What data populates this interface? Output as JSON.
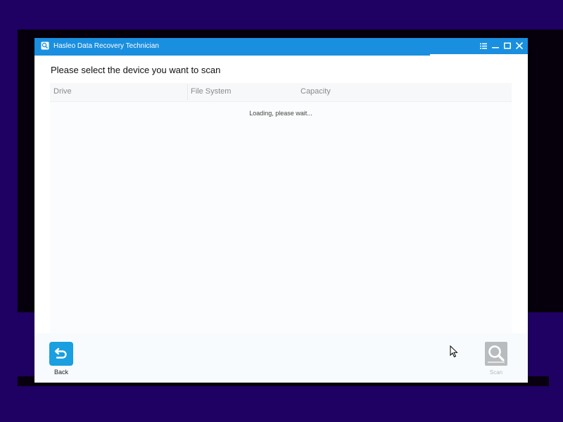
{
  "window": {
    "title": "Hasleo Data Recovery Technician",
    "app_icon": "hasleo-search-icon",
    "controls": {
      "menu_icon": "menu-list-icon",
      "minimize_icon": "minimize-icon",
      "maximize_icon": "maximize-icon",
      "close_icon": "close-icon"
    }
  },
  "main": {
    "heading": "Please select the device you want to scan",
    "table": {
      "columns": [
        "Drive",
        "File System",
        "Capacity"
      ],
      "status": "Loading, please wait..."
    }
  },
  "footer": {
    "back": {
      "label": "Back",
      "icon": "back-arrow-icon"
    },
    "scan": {
      "label": "Scan",
      "icon": "magnifier-icon",
      "enabled": false
    }
  },
  "colors": {
    "accent": "#1a8fe0",
    "back_button": "#1a9fe0",
    "disabled": "#b9bcbf",
    "desktop": "#1f0063"
  }
}
